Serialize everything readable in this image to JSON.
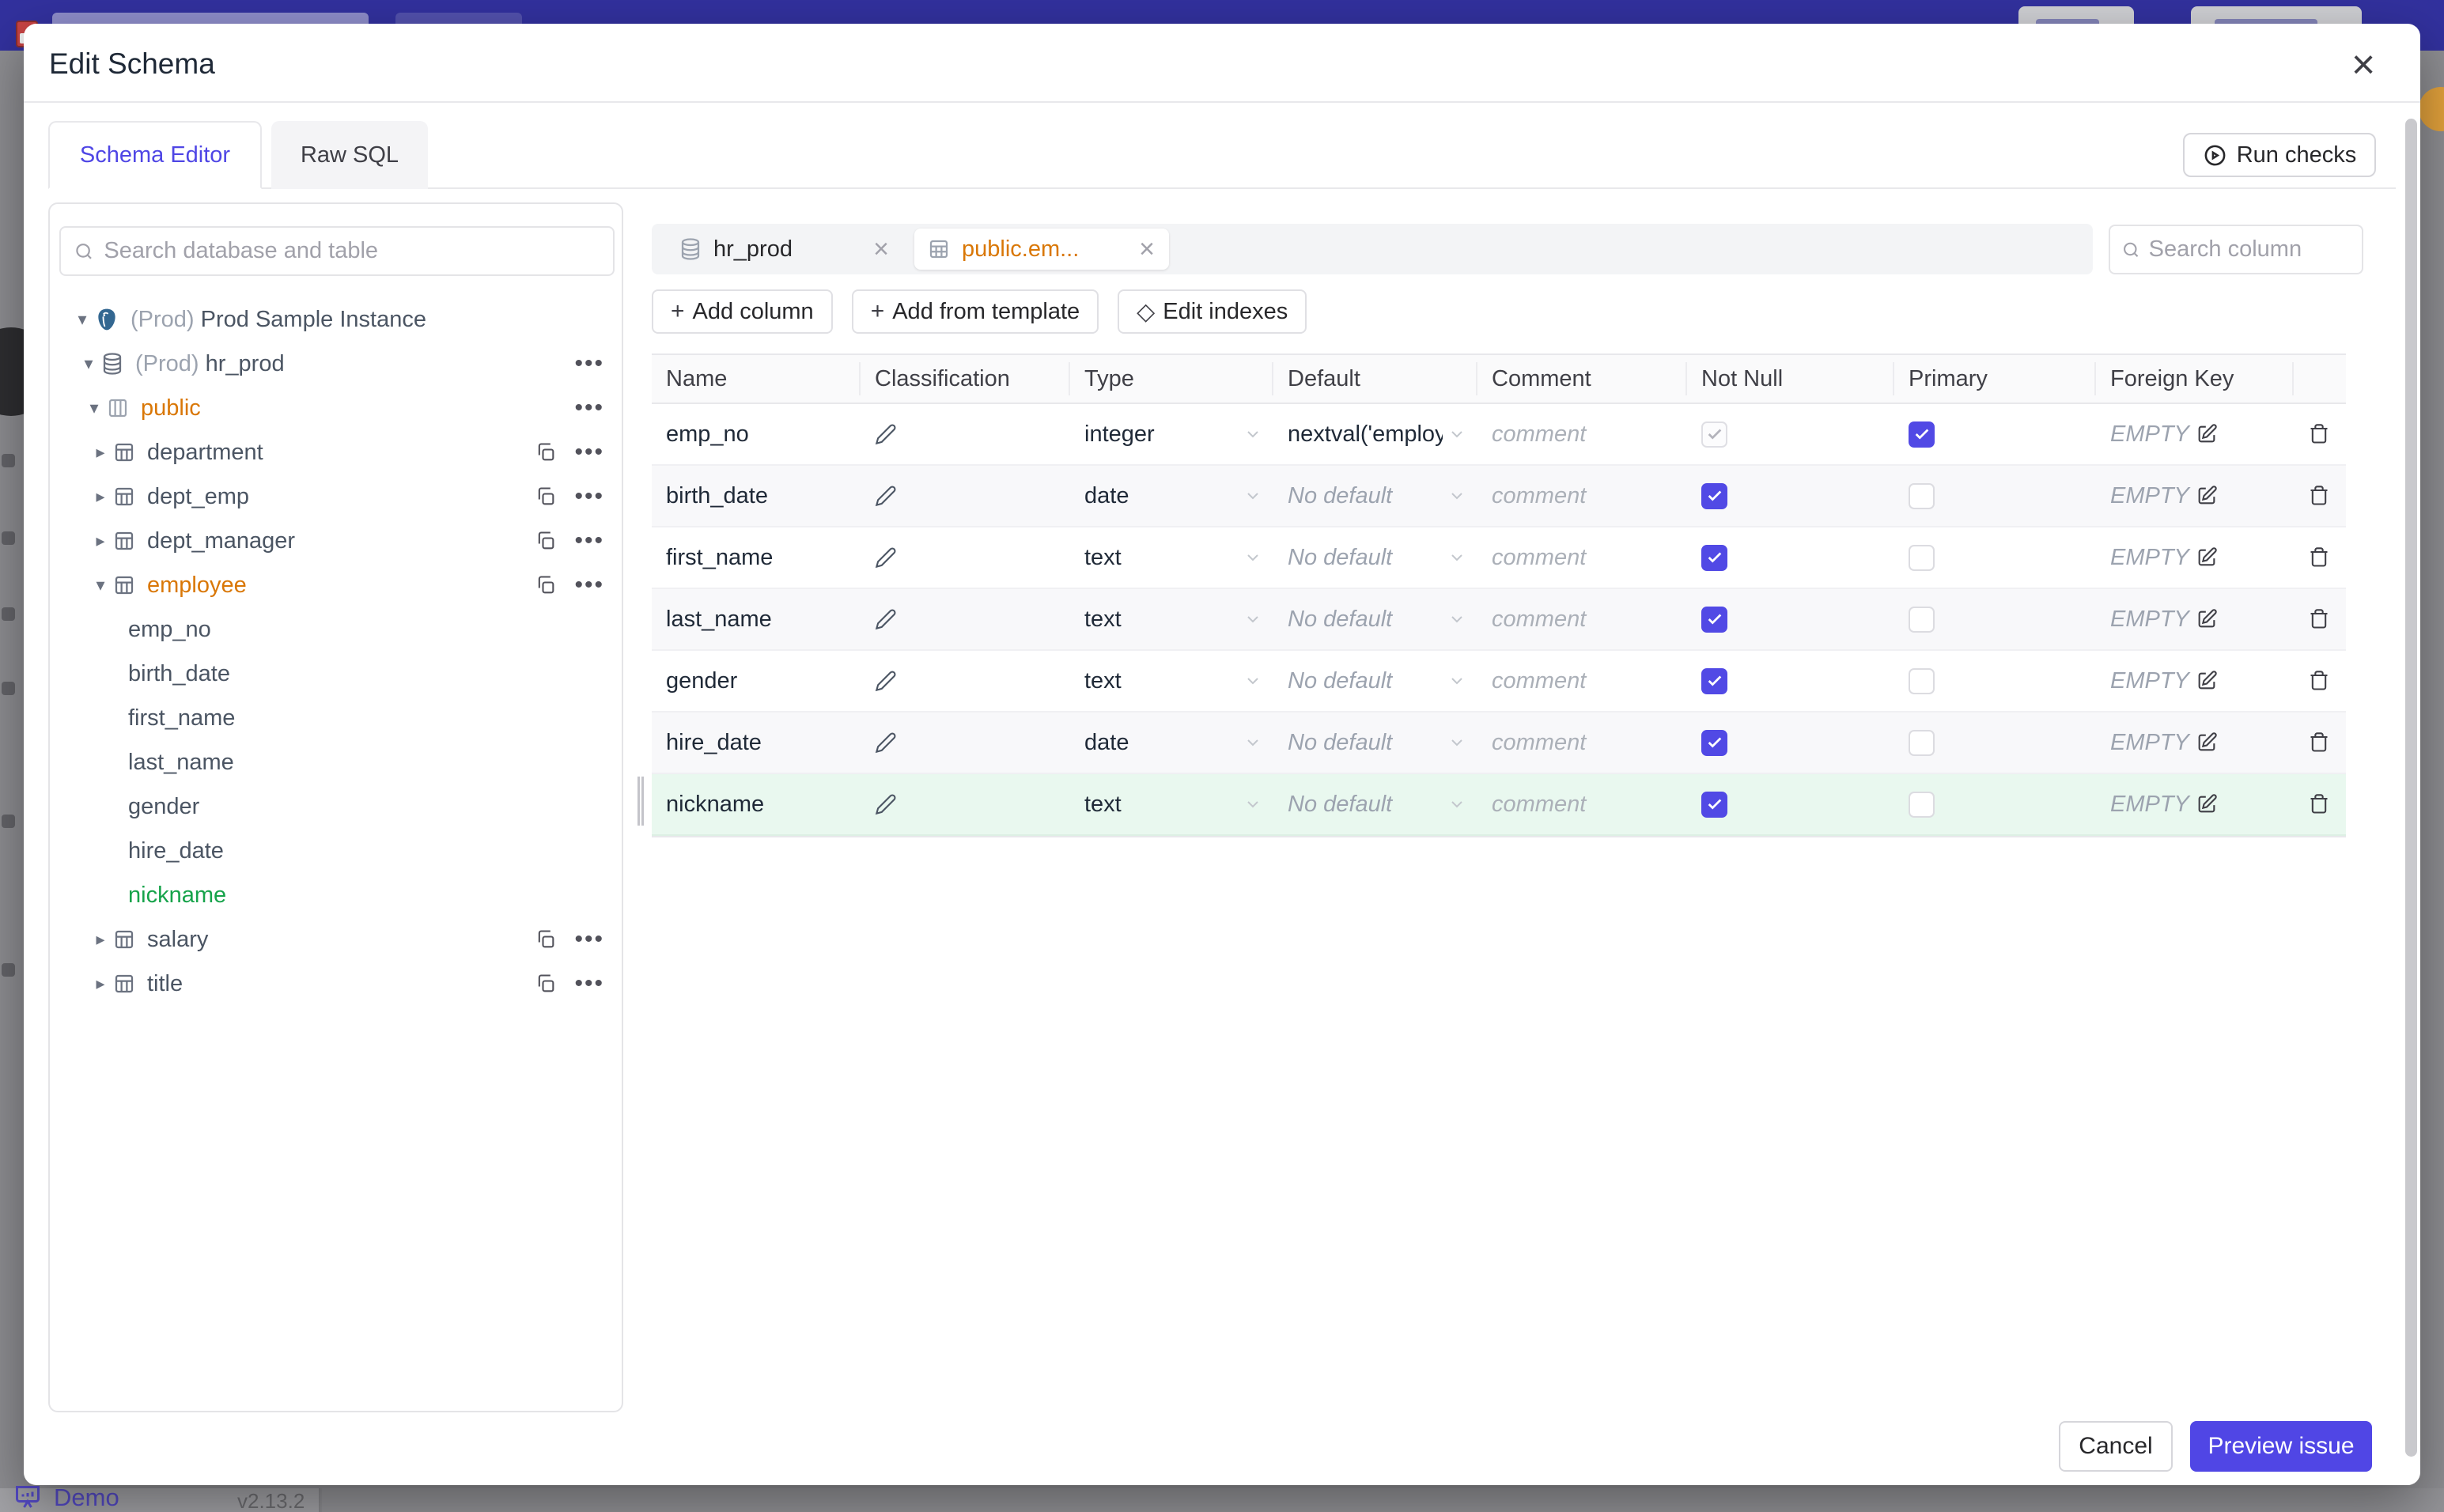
{
  "colors": {
    "accent": "#4F46E5",
    "amber": "#D97706",
    "green": "#16A34A",
    "navbar": "#32319E",
    "new_row_bg": "#E9F8EF",
    "selected_tree_bg": "#E4E1FA"
  },
  "backdrop": {
    "statusbar": {
      "demo_label": "Demo",
      "version": "v2.13.2"
    }
  },
  "modal": {
    "title": "Edit Schema",
    "close_icon": "×",
    "tabs": [
      {
        "label": "Schema Editor",
        "active": true
      },
      {
        "label": "Raw SQL",
        "active": false
      }
    ],
    "run_checks_label": "Run checks",
    "sidebar": {
      "search_placeholder": "Search database and table",
      "tree": [
        {
          "type": "instance",
          "prefix": "(Prod)",
          "name": "Prod Sample Instance",
          "expanded": true
        },
        {
          "type": "database",
          "prefix": "(Prod)",
          "name": "hr_prod",
          "expanded": true
        },
        {
          "type": "schema",
          "name": "public",
          "expanded": true
        },
        {
          "type": "table",
          "name": "department",
          "expanded": false
        },
        {
          "type": "table",
          "name": "dept_emp",
          "expanded": false
        },
        {
          "type": "table",
          "name": "dept_manager",
          "expanded": false
        },
        {
          "type": "table",
          "name": "employee",
          "expanded": true,
          "selected": true
        },
        {
          "type": "column",
          "name": "emp_no"
        },
        {
          "type": "column",
          "name": "birth_date"
        },
        {
          "type": "column",
          "name": "first_name"
        },
        {
          "type": "column",
          "name": "last_name"
        },
        {
          "type": "column",
          "name": "gender"
        },
        {
          "type": "column",
          "name": "hire_date"
        },
        {
          "type": "column",
          "name": "nickname",
          "new": true
        },
        {
          "type": "table",
          "name": "salary",
          "expanded": false
        },
        {
          "type": "table",
          "name": "title",
          "expanded": false
        }
      ]
    },
    "main": {
      "chips": [
        {
          "label": "hr_prod",
          "icon": "database",
          "active": false
        },
        {
          "label": "public.em...",
          "icon": "table",
          "active": true
        }
      ],
      "toolbar": {
        "add_column": "Add column",
        "add_from_template": "Add from template",
        "edit_indexes": "Edit indexes",
        "plus_symbol": "+",
        "diamond_symbol": "◇"
      },
      "column_search_placeholder": "Search column",
      "table": {
        "headers": [
          "Name",
          "Classification",
          "Type",
          "Default",
          "Comment",
          "Not Null",
          "Primary",
          "Foreign Key"
        ],
        "rows": [
          {
            "name": "emp_no",
            "type": "integer",
            "default": "nextval('employ",
            "comment_placeholder": "comment",
            "not_null": true,
            "not_null_disabled": true,
            "primary": true,
            "foreign_key": "EMPTY"
          },
          {
            "name": "birth_date",
            "type": "date",
            "default": "No default",
            "comment_placeholder": "comment",
            "not_null": true,
            "primary": false,
            "foreign_key": "EMPTY"
          },
          {
            "name": "first_name",
            "type": "text",
            "default": "No default",
            "comment_placeholder": "comment",
            "not_null": true,
            "primary": false,
            "foreign_key": "EMPTY"
          },
          {
            "name": "last_name",
            "type": "text",
            "default": "No default",
            "comment_placeholder": "comment",
            "not_null": true,
            "primary": false,
            "foreign_key": "EMPTY"
          },
          {
            "name": "gender",
            "type": "text",
            "default": "No default",
            "comment_placeholder": "comment",
            "not_null": true,
            "primary": false,
            "foreign_key": "EMPTY"
          },
          {
            "name": "hire_date",
            "type": "date",
            "default": "No default",
            "comment_placeholder": "comment",
            "not_null": true,
            "primary": false,
            "foreign_key": "EMPTY"
          },
          {
            "name": "nickname",
            "type": "text",
            "default": "No default",
            "comment_placeholder": "comment",
            "not_null": true,
            "primary": false,
            "foreign_key": "EMPTY",
            "new": true
          }
        ]
      }
    },
    "footer": {
      "cancel": "Cancel",
      "preview": "Preview issue"
    }
  }
}
